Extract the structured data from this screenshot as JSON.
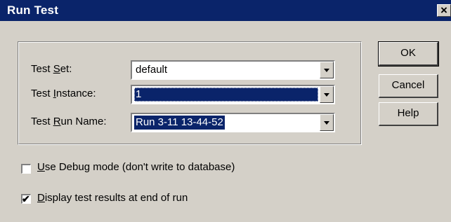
{
  "window": {
    "title": "Run Test",
    "close_glyph": "×"
  },
  "form": {
    "test_set": {
      "label_pre": "Test ",
      "label_u": "S",
      "label_post": "et:",
      "value": "default"
    },
    "test_instance": {
      "label_pre": "Test ",
      "label_u": "I",
      "label_post": "nstance:",
      "value": "1"
    },
    "test_run_name": {
      "label_pre": "Test ",
      "label_u": "R",
      "label_post": "un Name:",
      "value": "Run 3-11 13-44-52"
    }
  },
  "buttons": {
    "ok": "OK",
    "cancel": "Cancel",
    "help": "Help"
  },
  "options": {
    "debug": {
      "u": "U",
      "rest": "se Debug mode (don't write to database)",
      "checked": false
    },
    "display": {
      "u": "D",
      "rest": "isplay test results at end of run",
      "checked": true,
      "mark": "✔"
    }
  },
  "colors": {
    "titlebar": "#0a246a",
    "face": "#d4d0c8",
    "selection": "#0a246a"
  }
}
